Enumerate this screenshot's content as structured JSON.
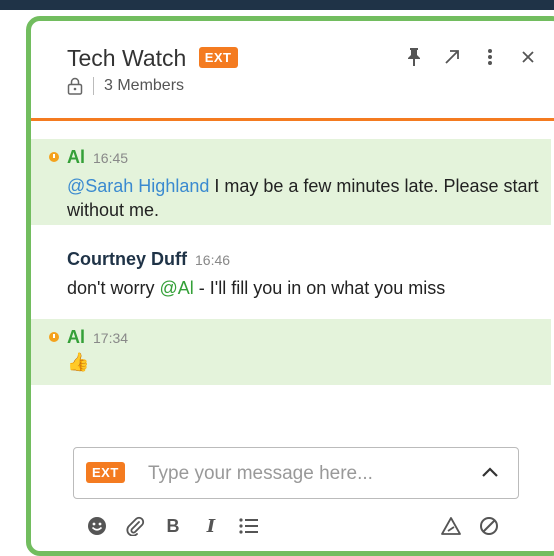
{
  "channel": {
    "title": "Tech Watch",
    "ext_badge": "EXT",
    "members": "3 Members"
  },
  "messages": [
    {
      "author": "Al",
      "time": "16:45",
      "mention": "@Sarah Highland",
      "text": " I may be a few minutes late. Please start without me."
    },
    {
      "author": "Courtney Duff",
      "time": "16:46",
      "text_before": "don't worry ",
      "mention": "@Al",
      "text_after": " - I'll fill you in on what you miss"
    },
    {
      "author": "Al",
      "time": "17:34",
      "emoji": "👍"
    }
  ],
  "composer": {
    "ext_badge": "EXT",
    "placeholder": "Type your message here..."
  },
  "colors": {
    "accent_green": "#72bd5f",
    "accent_orange": "#f47b20",
    "mention_blue": "#3a8ad0",
    "highlight_bg": "#e4f3db"
  }
}
